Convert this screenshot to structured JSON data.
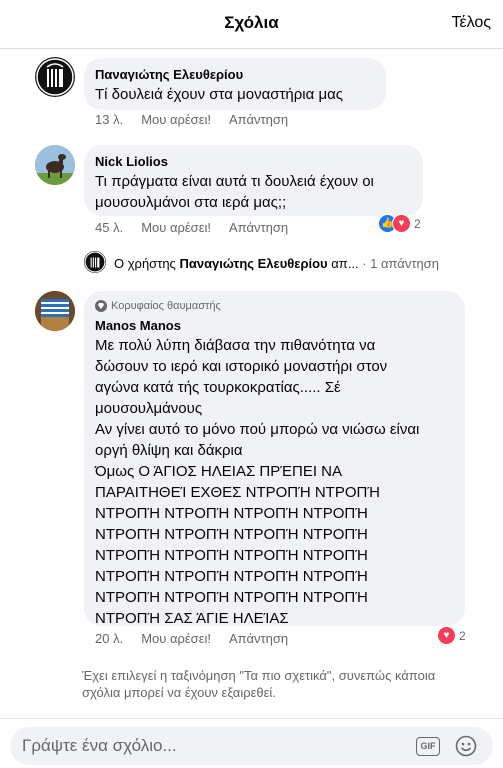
{
  "header": {
    "title": "Σχόλια",
    "done_label": "Τέλος"
  },
  "comments": [
    {
      "author": "Παναγιώτης Ελευθερίου",
      "text": "Τί δουλειά έχουν στα μοναστήρια μας",
      "time": "13 λ.",
      "like_label": "Μου αρέσει!",
      "reply_label": "Απάντηση"
    },
    {
      "author": "Nick Liolios",
      "text_lines": [
        "Τι πράγματα είναι αυτά τι δουλειά έχουν οι",
        "μουσουλμάνοι στα ιερά μας;;"
      ],
      "time": "45 λ.",
      "like_label": "Μου αρέσει!",
      "reply_label": "Απάντηση",
      "reactions": {
        "count": "2",
        "types": [
          "like-icon",
          "love-icon"
        ]
      },
      "reply_preview": {
        "prefix": "Ο χρήστης",
        "author": "Παναγιώτης Ελευθερίου",
        "suffix": "απ...",
        "count_text": "· 1 απάντηση"
      }
    },
    {
      "badge": "Κορυφαίος θαυμαστής",
      "author": "Manos Manos",
      "text_lines": [
        "Με πολύ λύπη διάβασα την πιθανότητα να",
        "δώσουν το ιερό και ιστορικό μοναστήρι στον",
        "αγώνα κατά τής τουρκοκρατίας..... Σέ",
        "μουσουλμάνους",
        "Αν γίνει αυτό το μόνο πού μπορώ να νιώσω είναι",
        "οργή θλίψη και δάκρια",
        "Όμως Ο ΆΓΙΟΣ ΗΛΕΙΑΣ ΠΡΈΠΕΙ ΝΑ",
        "ΠΑΡΑΙΤΗΘΕΊ ΕΧΘΕΣ ΝΤΡΟΠΉ  ΝΤΡΟΠΉ",
        "ΝΤΡΟΠΉ ΝΤΡΟΠΉ ΝΤΡΟΠΉ ΝΤΡΟΠΉ",
        "ΝΤΡΟΠΉ ΝΤΡΟΠΉ ΝΤΡΟΠΉ ΝΤΡΟΠΉ",
        "ΝΤΡΟΠΉ ΝΤΡΟΠΉ ΝΤΡΟΠΉ ΝΤΡΟΠΉ",
        "ΝΤΡΟΠΉ ΝΤΡΟΠΉ ΝΤΡΟΠΉ ΝΤΡΟΠΉ",
        "ΝΤΡΟΠΉ ΝΤΡΟΠΉ ΝΤΡΟΠΉ ΝΤΡΟΠΉ",
        "ΝΤΡΟΠΉ ΣΑΣ ΆΓΙΕ ΗΛΕΊΑΣ"
      ],
      "time": "20 λ.",
      "like_label": "Μου αρέσει!",
      "reply_label": "Απάντηση",
      "reactions": {
        "count": "2",
        "types": [
          "love-icon"
        ]
      }
    }
  ],
  "sort_note": "Έχει επιλεγεί η ταξινόμηση \"Τα πιο σχετικά\", συνεπώς κάποια σχόλια μπορεί να έχουν εξαιρεθεί.",
  "composer": {
    "placeholder": "Γράψτε ένα σχόλιο...",
    "gif_label": "GIF"
  },
  "colors": {
    "like": "#1877f2",
    "love": "#f33e58",
    "bubble": "#f0f2f5",
    "meta": "#65676b"
  }
}
